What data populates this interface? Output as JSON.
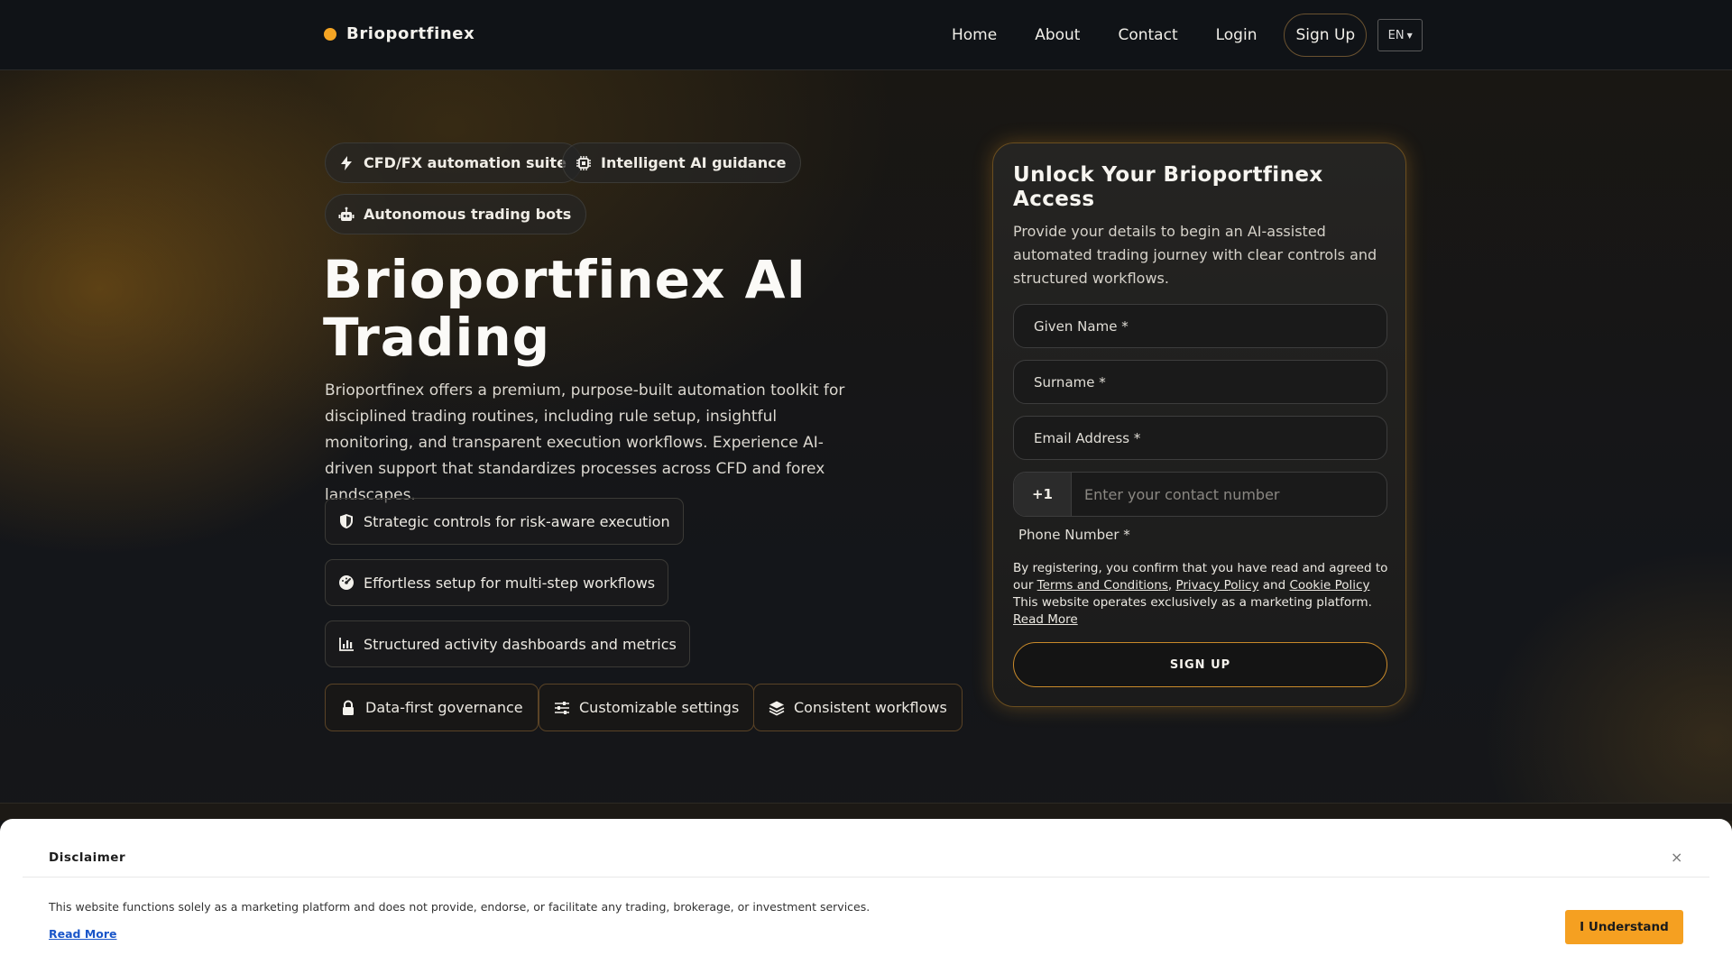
{
  "brand": {
    "name": "Brioportfinex",
    "accent": "#f5a524"
  },
  "nav": {
    "links": [
      "Home",
      "About",
      "Contact",
      "Login"
    ],
    "signup": "Sign Up",
    "language": "EN"
  },
  "hero": {
    "chips": [
      {
        "label": "CFD/FX automation suite",
        "icon": "bolt-icon"
      },
      {
        "label": "Intelligent AI guidance",
        "icon": "chip-icon"
      },
      {
        "label": "Autonomous trading bots",
        "icon": "robot-icon"
      }
    ],
    "title": "Brioportfinex AI Trading",
    "description": "Brioportfinex offers a premium, purpose-built automation toolkit for disciplined trading routines, including rule setup, insightful monitoring, and transparent execution workflows. Experience AI-driven support that standardizes processes across CFD and forex landscapes.",
    "features": [
      {
        "label": "Strategic controls for risk-aware execution",
        "icon": "shield-icon"
      },
      {
        "label": "Effortless setup for multi-step workflows",
        "icon": "gauge-icon"
      },
      {
        "label": "Structured activity dashboards and metrics",
        "icon": "bar-chart-icon"
      }
    ],
    "tags": [
      {
        "label": "Data-first governance",
        "icon": "lock-icon"
      },
      {
        "label": "Customizable settings",
        "icon": "sliders-icon"
      },
      {
        "label": "Consistent workflows",
        "icon": "layers-icon"
      }
    ]
  },
  "form": {
    "title": "Unlock Your Brioportfinex Access",
    "description": "Provide your details to begin an AI-assisted automated trading journey with clear controls and structured workflows.",
    "given_name": "Given Name *",
    "surname": "Surname *",
    "email": "Email Address *",
    "phone_code": "+1",
    "phone_placeholder": "Enter your contact number",
    "phone_label": "Phone Number *",
    "legal": {
      "prefix": "By registering, you confirm that you have read and agreed to our",
      "terms": "Terms and Conditions",
      "sep1": ",",
      "privacy": "Privacy Policy",
      "and": "and",
      "cookie": "Cookie Policy",
      "suffix": "This website operates exclusively as a marketing platform.",
      "read_more": "Read More"
    },
    "submit": "SIGN UP"
  },
  "disclaimer": {
    "title": "Disclaimer",
    "close": "×",
    "text": "This website functions solely as a marketing platform and does not provide, endorse, or facilitate any trading, brokerage, or investment services.",
    "read_more": "Read More",
    "button": "I Understand",
    "button_color": "#f5a021"
  }
}
